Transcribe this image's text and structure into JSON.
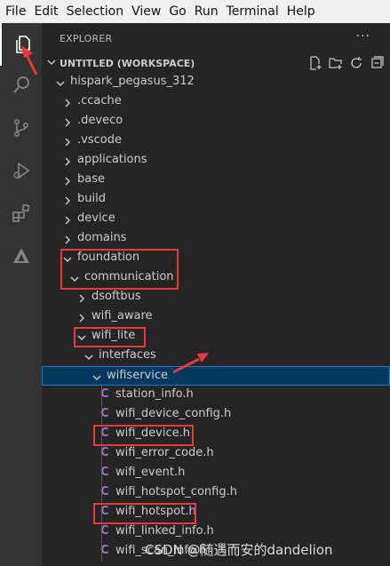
{
  "menu": [
    "File",
    "Edit",
    "Selection",
    "View",
    "Go",
    "Run",
    "Terminal",
    "Help"
  ],
  "activity_icons": [
    "explorer-icon",
    "search-icon",
    "source-control-icon",
    "run-debug-icon",
    "extensions-icon",
    "deveco-icon"
  ],
  "explorer": {
    "title": "EXPLORER",
    "more": "···",
    "workspace": "UNTITLED (WORKSPACE)",
    "actions": [
      "new-file-icon",
      "new-folder-icon",
      "refresh-icon",
      "collapse-all-icon"
    ]
  },
  "tree": [
    {
      "label": "hispark_pegasus_312",
      "type": "folder",
      "expanded": true,
      "depth": 0
    },
    {
      "label": ".ccache",
      "type": "folder",
      "expanded": false,
      "depth": 1
    },
    {
      "label": ".deveco",
      "type": "folder",
      "expanded": false,
      "depth": 1
    },
    {
      "label": ".vscode",
      "type": "folder",
      "expanded": false,
      "depth": 1
    },
    {
      "label": "applications",
      "type": "folder",
      "expanded": false,
      "depth": 1
    },
    {
      "label": "base",
      "type": "folder",
      "expanded": false,
      "depth": 1
    },
    {
      "label": "build",
      "type": "folder",
      "expanded": false,
      "depth": 1
    },
    {
      "label": "device",
      "type": "folder",
      "expanded": false,
      "depth": 1
    },
    {
      "label": "domains",
      "type": "folder",
      "expanded": false,
      "depth": 1
    },
    {
      "label": "foundation",
      "type": "folder",
      "expanded": true,
      "depth": 1
    },
    {
      "label": "communication",
      "type": "folder",
      "expanded": true,
      "depth": 2
    },
    {
      "label": "dsoftbus",
      "type": "folder",
      "expanded": false,
      "depth": 3
    },
    {
      "label": "wifi_aware",
      "type": "folder",
      "expanded": false,
      "depth": 3
    },
    {
      "label": "wifi_lite",
      "type": "folder",
      "expanded": true,
      "depth": 3
    },
    {
      "label": "interfaces",
      "type": "folder",
      "expanded": true,
      "depth": 4
    },
    {
      "label": "wifiservice",
      "type": "folder",
      "expanded": true,
      "depth": 5,
      "selected": true
    },
    {
      "label": "station_info.h",
      "type": "file",
      "depth": 6
    },
    {
      "label": "wifi_device_config.h",
      "type": "file",
      "depth": 6
    },
    {
      "label": "wifi_device.h",
      "type": "file",
      "depth": 6
    },
    {
      "label": "wifi_error_code.h",
      "type": "file",
      "depth": 6
    },
    {
      "label": "wifi_event.h",
      "type": "file",
      "depth": 6
    },
    {
      "label": "wifi_hotspot_config.h",
      "type": "file",
      "depth": 6
    },
    {
      "label": "wifi_hotspot.h",
      "type": "file",
      "depth": 6
    },
    {
      "label": "wifi_linked_info.h",
      "type": "file",
      "depth": 6
    },
    {
      "label": "wifi_scan_info.h",
      "type": "file",
      "depth": 6
    }
  ],
  "file_icon_glyph": "C",
  "colors": {
    "selection": "#04395e",
    "highlight": "#e8393c",
    "c_icon": "#a074c4"
  },
  "watermark": "CSDN @随遇而安的dandelion"
}
